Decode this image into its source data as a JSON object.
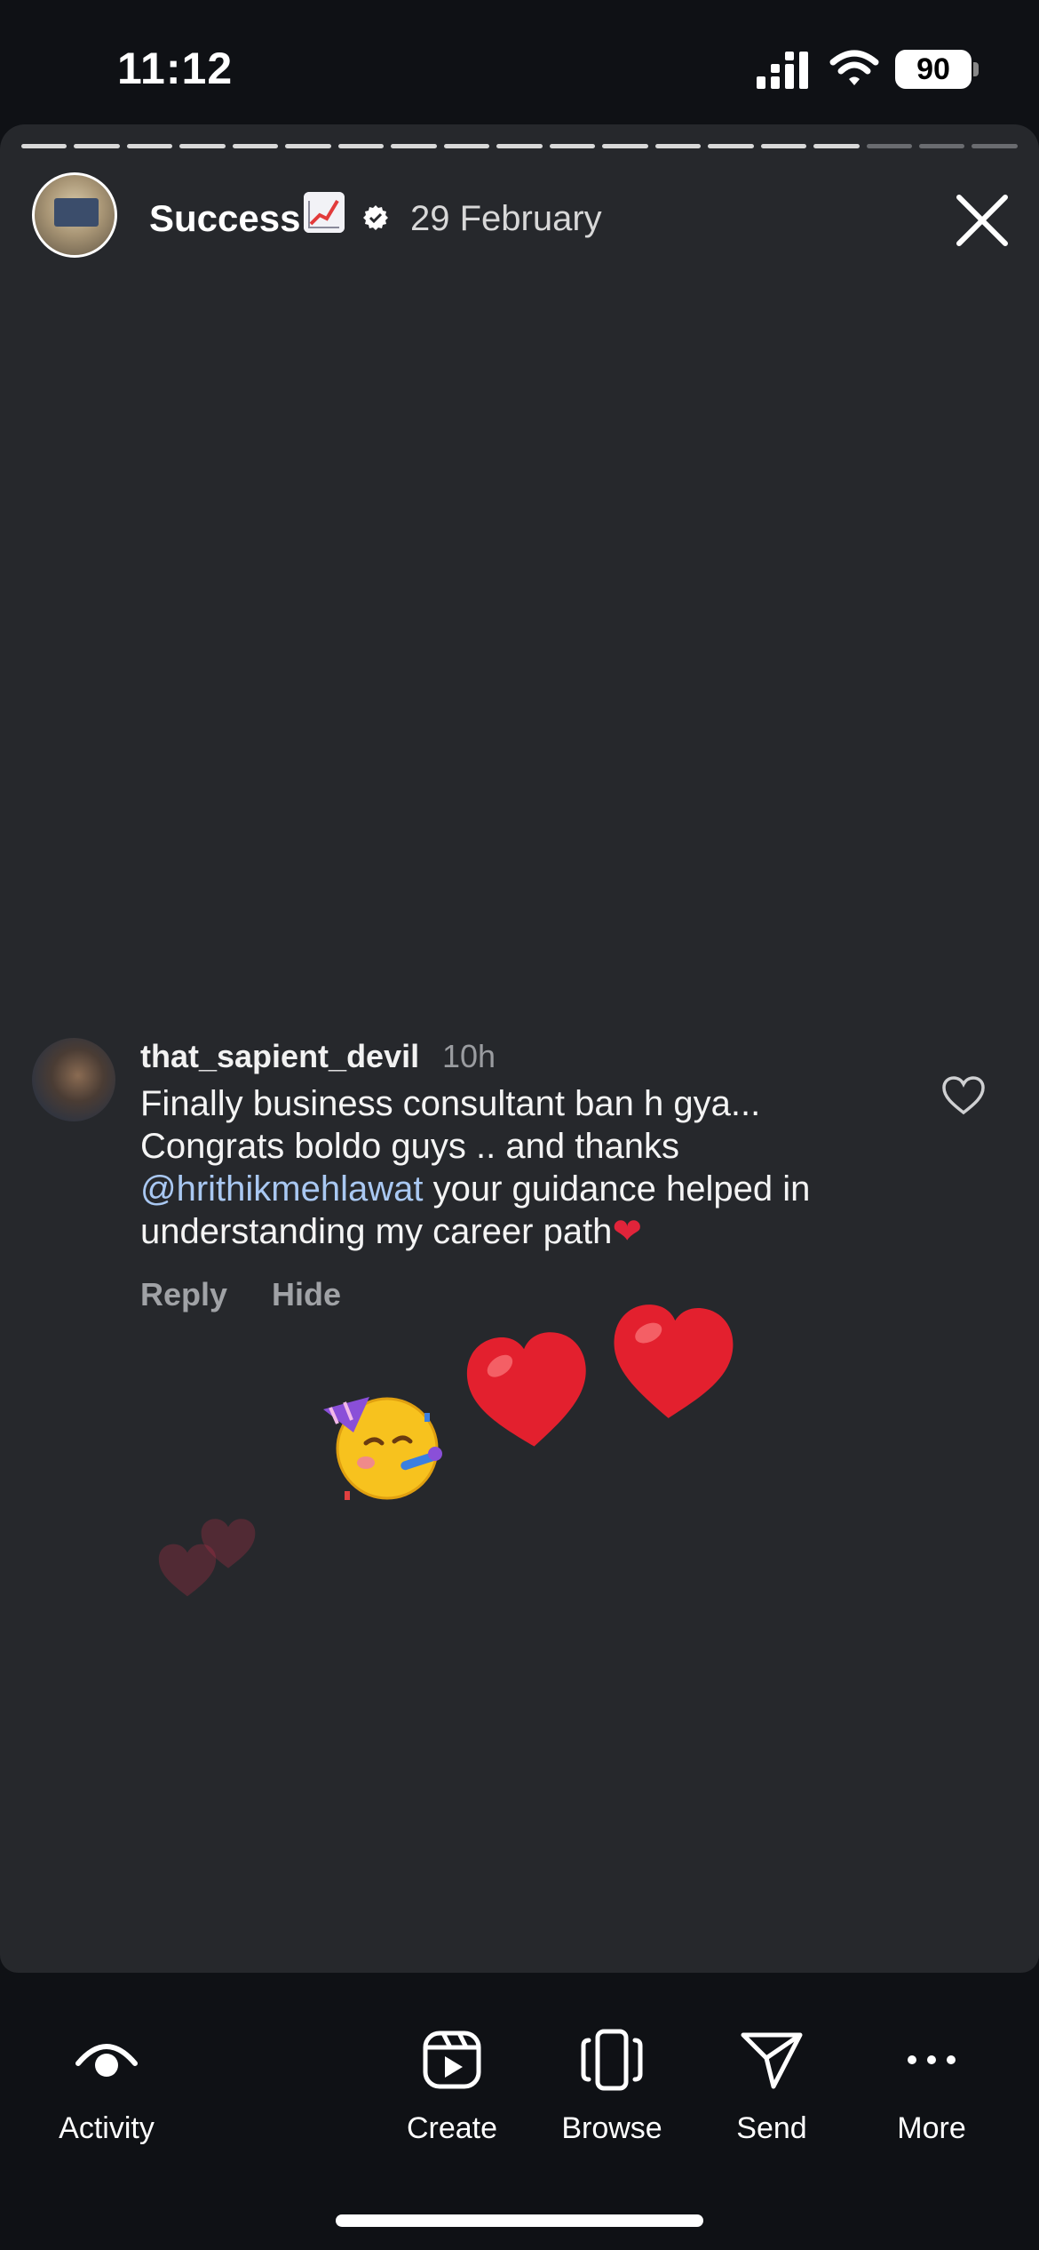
{
  "status_bar": {
    "time": "11:12",
    "battery": "90"
  },
  "story": {
    "segments_total": 19,
    "segments_viewed": 16,
    "username": "Success",
    "date": "29 February"
  },
  "comment": {
    "author": "that_sapient_devil",
    "time": "10h",
    "line1": "Finally business consultant ban h gya...",
    "line2": "Congrats boldo guys .. and thanks",
    "mention": "@hrithikmehlawat",
    "line3_rest": " your guidance helped in",
    "line4": "understanding my career path",
    "heart": "❤",
    "reply_label": "Reply",
    "hide_label": "Hide"
  },
  "bottom_nav": {
    "activity": "Activity",
    "create": "Create",
    "browse": "Browse",
    "send": "Send",
    "more": "More"
  },
  "colors": {
    "card_bg": "#26282c",
    "mention": "#a9c8f2",
    "heart": "#e0243a"
  }
}
